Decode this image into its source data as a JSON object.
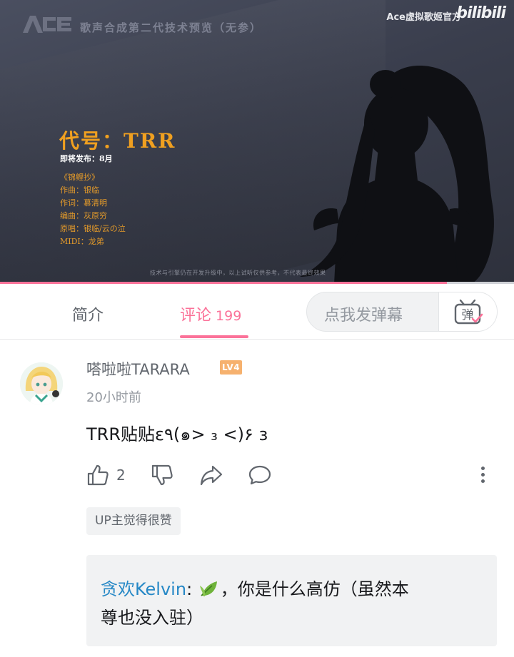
{
  "video": {
    "logo_text": "ACE",
    "title": "歌声合成第二代技术预览（无参）",
    "channel": "Ace虚拟歌姬官方",
    "site_logo": "bilibili",
    "codename": "代号：TRR",
    "release": "即将发布：8月",
    "credits": [
      "《锦鲤抄》",
      "作曲：银临",
      "作词：慕清明",
      "编曲：灰原穷",
      "原唱：银临/云の泣",
      "MIDI：龙弟"
    ],
    "disclaimer": "技术与引擎仍在开发升级中，以上试听仅供参考，不代表最终效果",
    "progress": 0.87,
    "colors": {
      "accent": "#fb7299",
      "title_orange": "#f0a020"
    }
  },
  "tabs": {
    "intro_label": "简介",
    "comments_label": "评论",
    "comments_count": "199",
    "danmaku_placeholder": "点我发弹幕",
    "danmaku_icon": "弹"
  },
  "comment": {
    "username": "嗒啦啦TARARA",
    "level": "LV4",
    "timestamp": "20小时前",
    "text": "TRR贴贴ε٩(๑> ₃ <)۶ з",
    "like_count": "2",
    "up_badge": "UP主觉得很赞",
    "reply": {
      "author": "贪欢Kelvin",
      "separator": ":",
      "text_after_emoji": "，你是什么高仿（虽然本",
      "text_line2": "尊也没入驻）"
    }
  }
}
